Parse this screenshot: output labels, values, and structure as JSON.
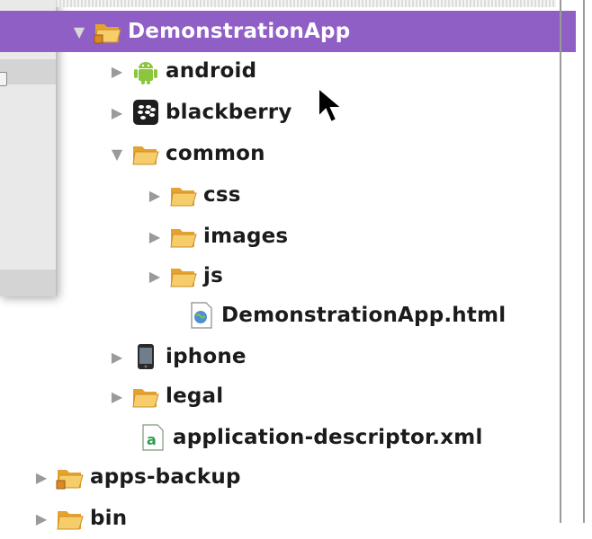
{
  "tree": {
    "items": [
      {
        "label": "DemonstrationApp",
        "icon": "project-folder-icon",
        "expanded": true,
        "selected": true
      },
      {
        "label": "android",
        "icon": "android-icon",
        "expanded": false
      },
      {
        "label": "blackberry",
        "icon": "blackberry-icon",
        "expanded": false
      },
      {
        "label": "common",
        "icon": "folder-icon",
        "expanded": true
      },
      {
        "label": "css",
        "icon": "folder-icon",
        "expanded": false
      },
      {
        "label": "images",
        "icon": "folder-icon",
        "expanded": false
      },
      {
        "label": "js",
        "icon": "folder-icon",
        "expanded": false
      },
      {
        "label": "DemonstrationApp.html",
        "icon": "html-file-icon"
      },
      {
        "label": "iphone",
        "icon": "iphone-icon",
        "expanded": false
      },
      {
        "label": "legal",
        "icon": "folder-icon",
        "expanded": false
      },
      {
        "label": "application-descriptor.xml",
        "icon": "xml-file-icon"
      },
      {
        "label": "apps-backup",
        "icon": "project-folder-icon",
        "expanded": false
      },
      {
        "label": "bin",
        "icon": "folder-icon",
        "expanded": false
      }
    ]
  },
  "colors": {
    "selection": "#8f5fc6",
    "folder": "#f0b23c",
    "android": "#8cc63f",
    "blackberry": "#1e1e1e"
  }
}
